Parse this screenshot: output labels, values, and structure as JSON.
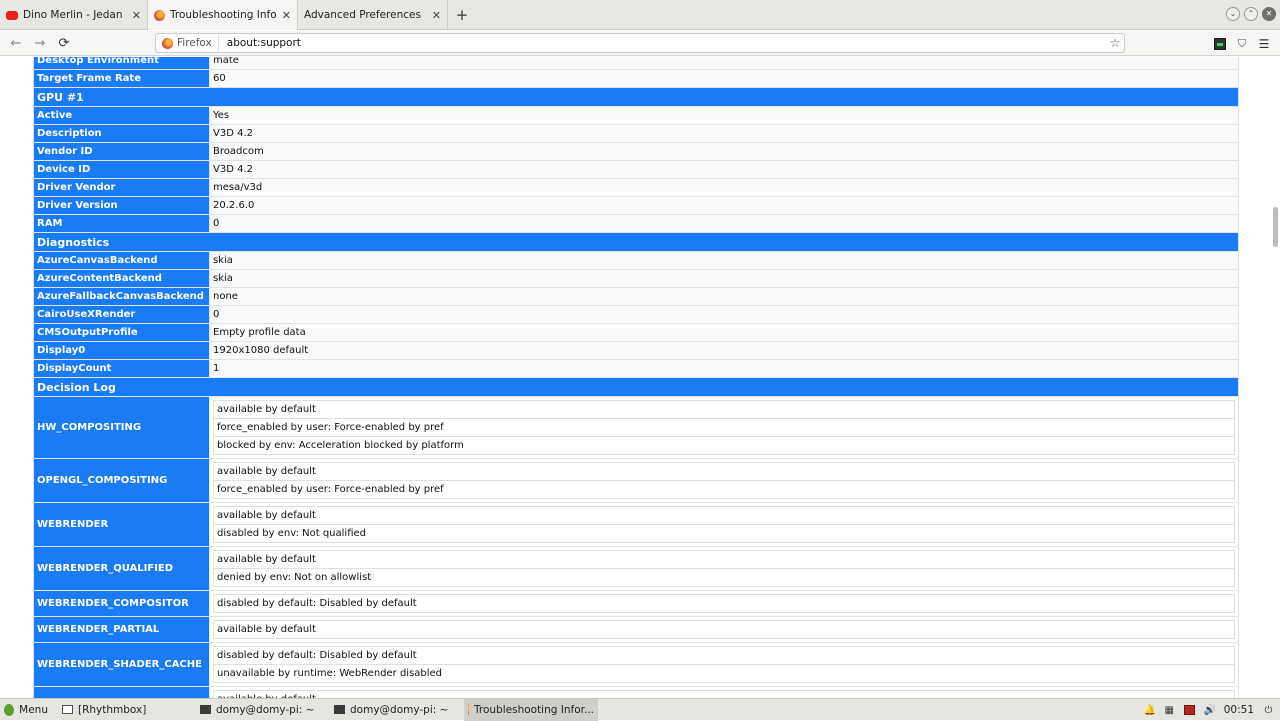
{
  "tabs": [
    {
      "title": "Dino Merlin - Jedan dan, J",
      "icon_color": "#e62117"
    },
    {
      "title": "Troubleshooting Informa",
      "icon_color": "#e4572e"
    },
    {
      "title": "Advanced Preferences",
      "icon_color": ""
    }
  ],
  "tab_close": "✕",
  "new_tab": "+",
  "nav": {
    "back": "←",
    "forward": "→",
    "reload": "⟳",
    "identity": "Firefox",
    "url": "about:support",
    "bookmark": "☆"
  },
  "content": {
    "rows_top": [
      {
        "key": "Desktop Environment",
        "value": "mate"
      },
      {
        "key": "Target Frame Rate",
        "value": "60"
      }
    ],
    "gpu_title": "GPU #1",
    "gpu_rows": [
      {
        "key": "Active",
        "value": "Yes"
      },
      {
        "key": "Description",
        "value": "V3D 4.2"
      },
      {
        "key": "Vendor ID",
        "value": "Broadcom"
      },
      {
        "key": "Device ID",
        "value": "V3D 4.2"
      },
      {
        "key": "Driver Vendor",
        "value": "mesa/v3d"
      },
      {
        "key": "Driver Version",
        "value": "20.2.6.0"
      },
      {
        "key": "RAM",
        "value": "0"
      }
    ],
    "diag_title": "Diagnostics",
    "diag_rows": [
      {
        "key": "AzureCanvasBackend",
        "value": "skia"
      },
      {
        "key": "AzureContentBackend",
        "value": "skia"
      },
      {
        "key": "AzureFallbackCanvasBackend",
        "value": "none"
      },
      {
        "key": "CairoUseXRender",
        "value": "0"
      },
      {
        "key": "CMSOutputProfile",
        "value": "Empty profile data"
      },
      {
        "key": "Display0",
        "value": "1920x1080 default"
      },
      {
        "key": "DisplayCount",
        "value": "1"
      }
    ],
    "decision_title": "Decision Log",
    "decision_rows": [
      {
        "key": "HW_COMPOSITING",
        "entries": [
          "available by default",
          "force_enabled by user: Force-enabled by pref",
          "blocked by env: Acceleration blocked by platform"
        ]
      },
      {
        "key": "OPENGL_COMPOSITING",
        "entries": [
          "available by default",
          "force_enabled by user: Force-enabled by pref"
        ]
      },
      {
        "key": "WEBRENDER",
        "entries": [
          "available by default",
          "disabled by env: Not qualified"
        ]
      },
      {
        "key": "WEBRENDER_QUALIFIED",
        "entries": [
          "available by default",
          "denied by env: Not on allowlist"
        ]
      },
      {
        "key": "WEBRENDER_COMPOSITOR",
        "entries": [
          "disabled by default: Disabled by default"
        ]
      },
      {
        "key": "WEBRENDER_PARTIAL",
        "entries": [
          "available by default"
        ]
      },
      {
        "key": "WEBRENDER_SHADER_CACHE",
        "entries": [
          "disabled by default: Disabled by default",
          "unavailable by runtime: WebRender disabled"
        ]
      },
      {
        "key": "",
        "entries": [
          "available by default"
        ]
      }
    ]
  },
  "taskbar": {
    "menu": "Menu",
    "items": [
      {
        "label": "[Rhythmbox]",
        "icon": "window-icon"
      },
      {
        "label": "domy@domy-pi: ~",
        "icon": "terminal-icon"
      },
      {
        "label": "domy@domy-pi: ~",
        "icon": "terminal-icon"
      },
      {
        "label": "Troubleshooting Infor...",
        "icon": "firefox-icon"
      }
    ],
    "clock": "00:51"
  }
}
